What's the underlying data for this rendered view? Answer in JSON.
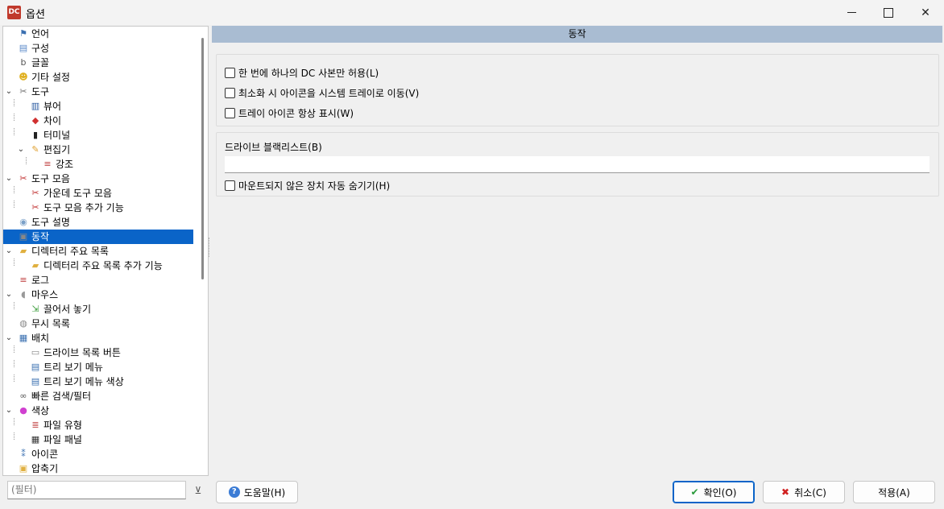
{
  "window": {
    "title": "옵션",
    "app_icon_text": "DC"
  },
  "tree": {
    "items": [
      {
        "label": "언어",
        "level": 0,
        "expander": "",
        "icon": "flag-icon",
        "color": "#3a6fb0"
      },
      {
        "label": "구성",
        "level": 0,
        "expander": "",
        "icon": "config-icon",
        "color": "#5a88c8"
      },
      {
        "label": "글꼴",
        "level": 0,
        "expander": "",
        "icon": "font-icon",
        "color": "#555555"
      },
      {
        "label": "기타 설정",
        "level": 0,
        "expander": "",
        "icon": "smiley-icon",
        "color": "#e0b020"
      },
      {
        "label": "도구",
        "level": 0,
        "expander": "expanded",
        "icon": "tools-icon",
        "color": "#707070"
      },
      {
        "label": "뷰어",
        "level": 1,
        "expander": "",
        "icon": "viewer-icon",
        "color": "#2a5aa0"
      },
      {
        "label": "차이",
        "level": 1,
        "expander": "",
        "icon": "diff-icon",
        "color": "#d03030"
      },
      {
        "label": "터미널",
        "level": 1,
        "expander": "",
        "icon": "terminal-icon",
        "color": "#222222"
      },
      {
        "label": "편집기",
        "level": 1,
        "expander": "expanded",
        "icon": "editor-icon",
        "color": "#e0a030"
      },
      {
        "label": "강조",
        "level": 2,
        "expander": "",
        "icon": "highlight-icon",
        "color": "#c04040"
      },
      {
        "label": "도구 모음",
        "level": 0,
        "expander": "expanded",
        "icon": "scissors-icon",
        "color": "#c03030"
      },
      {
        "label": "가운데 도구 모음",
        "level": 1,
        "expander": "",
        "icon": "scissors-icon",
        "color": "#c03030"
      },
      {
        "label": "도구 모음 추가 기능",
        "level": 1,
        "expander": "",
        "icon": "scissors-icon",
        "color": "#c03030"
      },
      {
        "label": "도구 설명",
        "level": 0,
        "expander": "",
        "icon": "lightbulb-icon",
        "color": "#7aa0c8"
      },
      {
        "label": "동작",
        "level": 0,
        "expander": "",
        "icon": "behavior-icon",
        "color": "#888888",
        "selected": true
      },
      {
        "label": "디렉터리 주요 목록",
        "level": 0,
        "expander": "expanded",
        "icon": "folder-icon",
        "color": "#e0b040"
      },
      {
        "label": "디렉터리 주요 목록 추가 기능",
        "level": 1,
        "expander": "",
        "icon": "folder-icon",
        "color": "#e0b040"
      },
      {
        "label": "로그",
        "level": 0,
        "expander": "",
        "icon": "log-icon",
        "color": "#c04040"
      },
      {
        "label": "마우스",
        "level": 0,
        "expander": "expanded",
        "icon": "mouse-icon",
        "color": "#999999"
      },
      {
        "label": "끌어서 놓기",
        "level": 1,
        "expander": "",
        "icon": "drag-drop-icon",
        "color": "#40a040"
      },
      {
        "label": "무시 목록",
        "level": 0,
        "expander": "",
        "icon": "ignore-list-icon",
        "color": "#888888"
      },
      {
        "label": "배치",
        "level": 0,
        "expander": "expanded",
        "icon": "layout-icon",
        "color": "#3a6fb0"
      },
      {
        "label": "드라이브 목록 버튼",
        "level": 1,
        "expander": "",
        "icon": "drive-icon",
        "color": "#888888"
      },
      {
        "label": "트리 보기 메뉴",
        "level": 1,
        "expander": "",
        "icon": "tree-menu-icon",
        "color": "#3a6fb0"
      },
      {
        "label": "트리 보기 메뉴 색상",
        "level": 1,
        "expander": "",
        "icon": "tree-menu-color-icon",
        "color": "#3a6fb0"
      },
      {
        "label": "빠른 검색/필터",
        "level": 0,
        "expander": "",
        "icon": "binoculars-icon",
        "color": "#555555"
      },
      {
        "label": "색상",
        "level": 0,
        "expander": "expanded",
        "icon": "color-wheel-icon",
        "color": "#d040d0"
      },
      {
        "label": "파일 유형",
        "level": 1,
        "expander": "",
        "icon": "file-type-icon",
        "color": "#c04040"
      },
      {
        "label": "파일 패널",
        "level": 1,
        "expander": "",
        "icon": "file-panel-icon",
        "color": "#333333"
      },
      {
        "label": "아이콘",
        "level": 0,
        "expander": "",
        "icon": "footprints-icon",
        "color": "#3a6fb0"
      },
      {
        "label": "압축기",
        "level": 0,
        "expander": "",
        "icon": "archiver-icon",
        "color": "#e0b040"
      }
    ]
  },
  "main": {
    "section_title": "동작",
    "options": [
      {
        "label": "한 번에 하나의 DC 사본만 허용(L)",
        "checked": false
      },
      {
        "label": "최소화 시 아이콘을 시스템 트레이로 이동(V)",
        "checked": false
      },
      {
        "label": "트레이 아이콘 항상 표시(W)",
        "checked": false
      }
    ],
    "drive_blacklist": {
      "title": "드라이브 블랙리스트(B)",
      "value": "",
      "auto_hide_label": "마운트되지 않은 장치 자동 숨기기(H)",
      "auto_hide_checked": false
    }
  },
  "footer": {
    "filter_placeholder": "(필터)",
    "help_label": "도움말(H)",
    "ok_label": "확인(O)",
    "cancel_label": "취소(C)",
    "apply_label": "적용(A)"
  }
}
